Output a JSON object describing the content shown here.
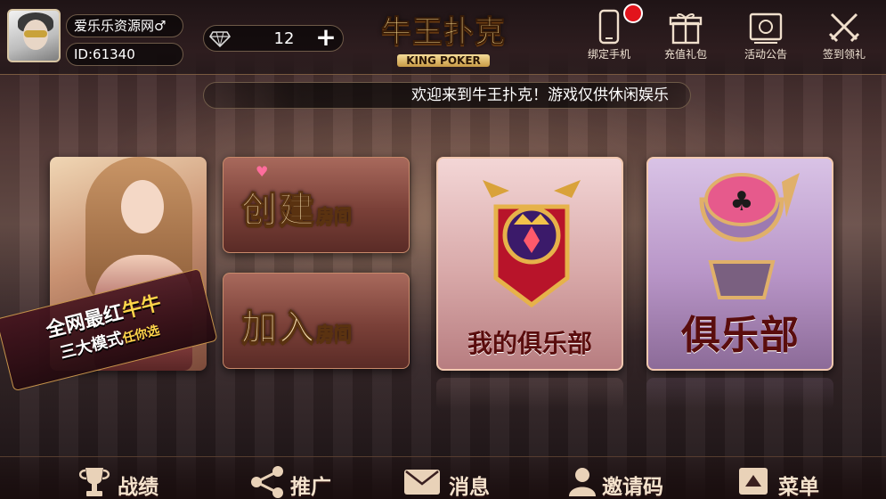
{
  "user": {
    "name": "爱乐乐资源网♂",
    "id": "ID:61340"
  },
  "currency": {
    "diamonds": "12",
    "add_label": "+"
  },
  "logo": {
    "main": "牛王扑克",
    "sub": "KING POKER"
  },
  "top_actions": [
    {
      "label": "绑定手机",
      "icon": "phone-icon"
    },
    {
      "label": "充值礼包",
      "icon": "gift-icon"
    },
    {
      "label": "活动公告",
      "icon": "announcement-icon"
    },
    {
      "label": "签到领礼",
      "icon": "checkin-icon"
    }
  ],
  "marquee": "欢迎来到牛王扑克！游戏仅供休闲娱乐",
  "banner": {
    "line1_a": "全网最红",
    "line1_b": "牛牛",
    "line2_a": "三大模式",
    "line2_b": "任你选"
  },
  "rooms": {
    "create_big": "创建",
    "create_small": "房间",
    "join_big": "加入",
    "join_small": "房间"
  },
  "clubs": {
    "my_club": "我的俱乐部",
    "club": "俱乐部"
  },
  "bottom_nav": [
    {
      "label": "战绩",
      "icon": "trophy-icon"
    },
    {
      "label": "推广",
      "icon": "share-icon"
    },
    {
      "label": "消息",
      "icon": "mail-icon"
    },
    {
      "label": "邀请码",
      "icon": "user-icon"
    },
    {
      "label": "菜单",
      "icon": "menu-icon"
    }
  ],
  "colors": {
    "accent_gold": "#f7d88a",
    "notification_red": "#e2141c"
  }
}
